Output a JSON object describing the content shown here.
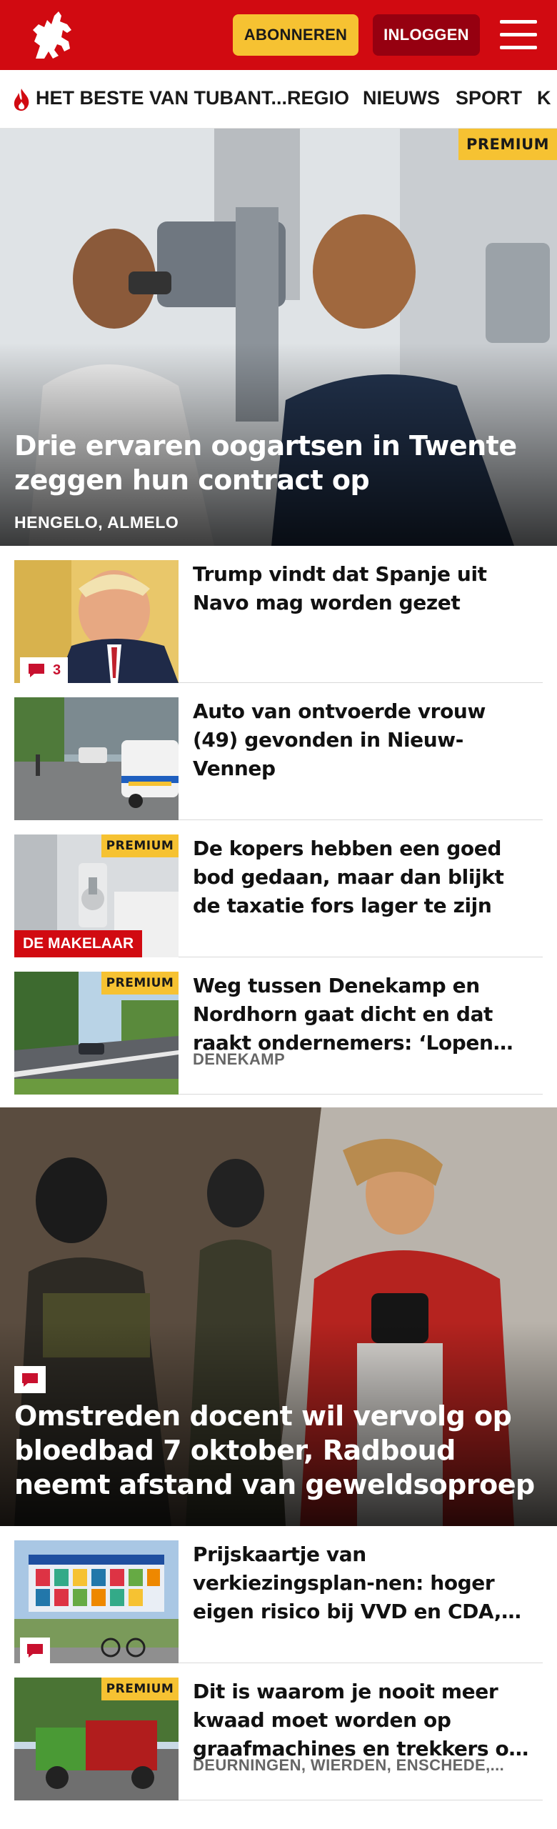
{
  "header": {
    "subscribe_label": "ABONNEREN",
    "login_label": "INLOGGEN"
  },
  "nav": {
    "items": [
      "HET BESTE VAN TUBANT...",
      "REGIO",
      "NIEUWS",
      "SPORT",
      "K"
    ]
  },
  "hero": {
    "badge": "PREMIUM",
    "title": "Drie ervaren oogartsen in Twente zeggen hun contract op",
    "location": "HENGELO, ALMELO"
  },
  "articles": [
    {
      "title": "Trump vindt dat Spanje uit Navo mag worden gezet",
      "comments": "3"
    },
    {
      "title": "Auto van ontvoerde vrouw (49) gevonden in Nieuw-Vennep"
    },
    {
      "title": "De kopers hebben een goed bod gedaan, maar dan blijkt de taxatie fors lager te zijn",
      "badge": "PREMIUM",
      "label": "DE MAKELAAR"
    },
    {
      "title": "Weg tussen Denekamp en Nordhorn gaat dicht en dat raakt ondernemers: ‘Lopen klanten...",
      "badge": "PREMIUM",
      "location": "DENEKAMP"
    }
  ],
  "big_story": {
    "title": "Omstreden docent wil vervolg op bloedbad 7 oktober, Radboud neemt afstand van geweldsoproep"
  },
  "articles2": [
    {
      "title": "Prijskaartje van verkiezingsplan-nen: hoger eigen risico bij VVD en CDA, hogere AOW-leeftijd bij..."
    },
    {
      "title": "Dit is waarom je nooit meer kwaad moet worden op graafmachines en trekkers op d...",
      "badge": "PREMIUM",
      "location": "DEURNINGEN, WIERDEN, ENSCHEDE,..."
    }
  ],
  "colors": {
    "brand_red": "#d10a11",
    "premium_yellow": "#f6c232",
    "login_dark_red": "#960010"
  }
}
